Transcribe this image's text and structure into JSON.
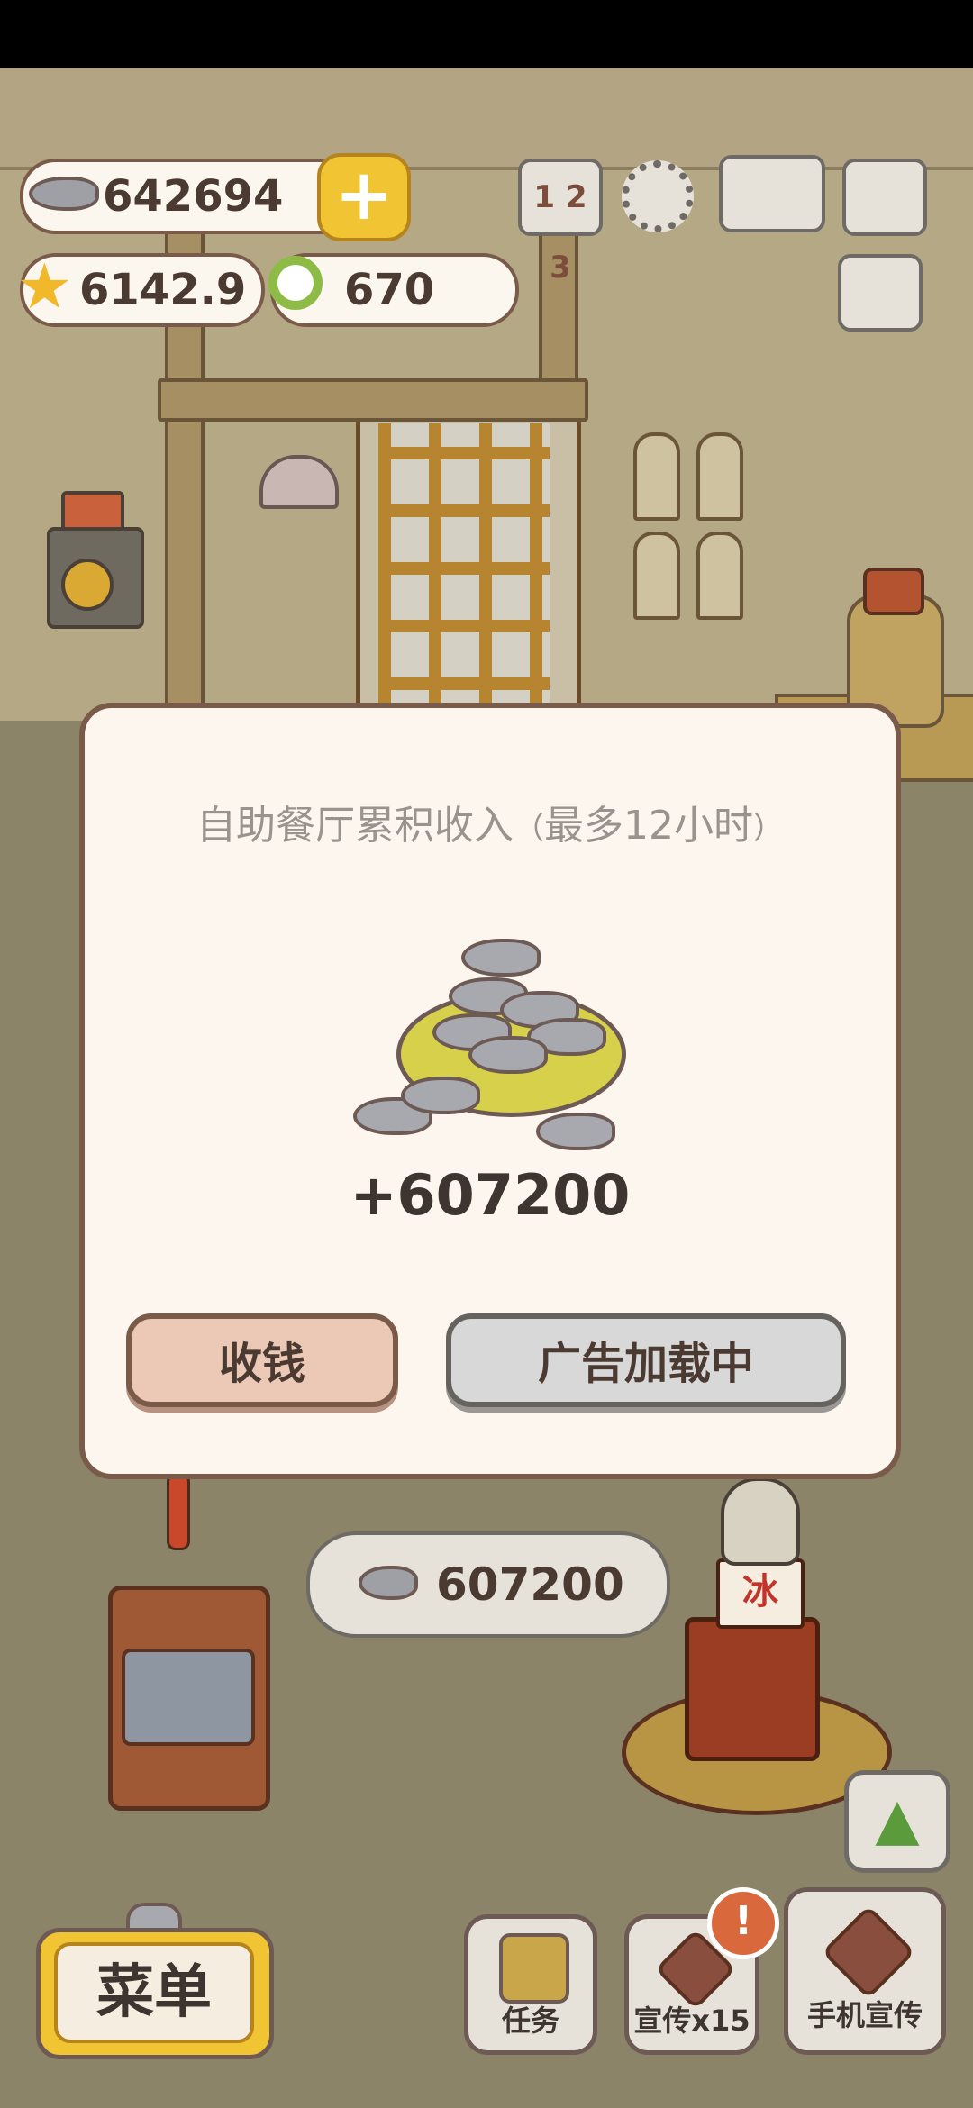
{
  "hud": {
    "fish_currency": "642694",
    "plus_label": "+",
    "stars": "6142.9",
    "coins": "670",
    "ranking_label": "1 2 3"
  },
  "dialog": {
    "title": "自助餐厅累积收入",
    "title_paren_open": "（",
    "title_note": "最多12小时",
    "title_paren_close": "）",
    "amount": "+607200",
    "collect_button": "收钱",
    "ad_button": "广告加载中"
  },
  "scene": {
    "fish_counter": "607200",
    "ice_sign": "冰"
  },
  "bottom_bar": {
    "menu": "菜单",
    "task": "任务",
    "promote": "宣传x15",
    "promote_badge": "!",
    "phone_promote": "手机宣传"
  },
  "colors": {
    "accent_yellow": "#f0c433",
    "modal_bg": "#fcf6ee",
    "border_brown": "#7a5b4a",
    "collect_btn": "#ecc9b6",
    "ad_btn": "#d9d8d8"
  },
  "icons": {
    "fish": "fish-icon",
    "plus": "plus-icon",
    "star": "star-icon",
    "coin": "coin-icon",
    "ranking": "ranking-icon",
    "settings": "gear-icon",
    "book": "book-icon",
    "camera": "camera-icon",
    "news": "newspaper-icon",
    "arrow_up": "arrow-up-icon"
  }
}
